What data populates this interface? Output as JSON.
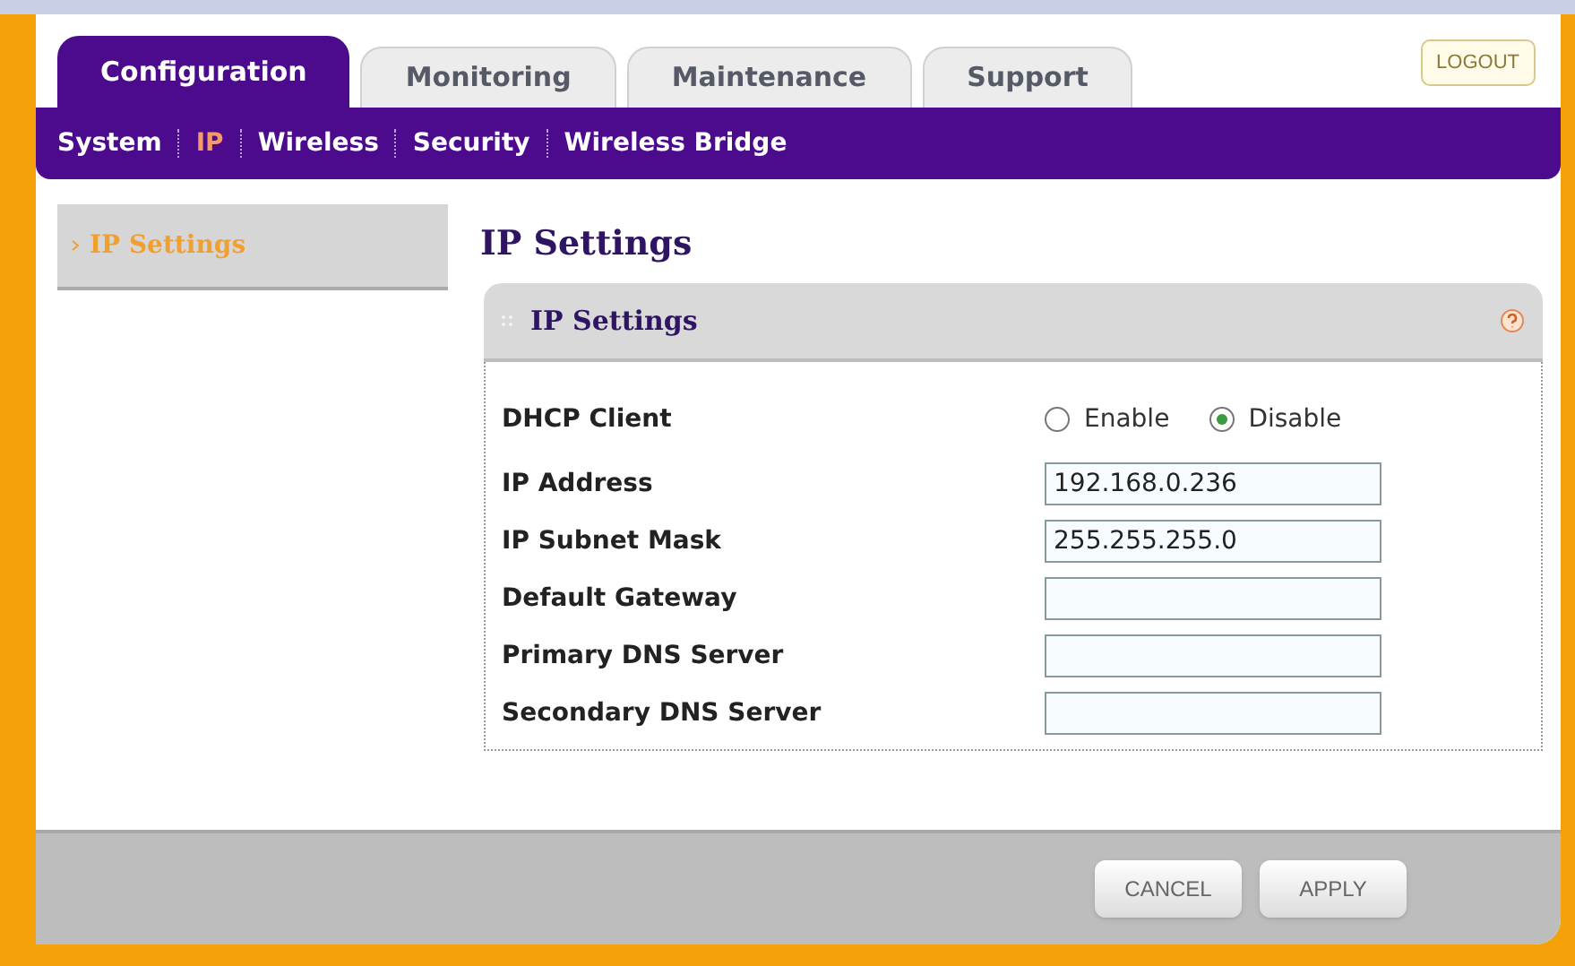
{
  "tabs": [
    {
      "label": "Configuration",
      "selected": true
    },
    {
      "label": "Monitoring",
      "selected": false
    },
    {
      "label": "Maintenance",
      "selected": false
    },
    {
      "label": "Support",
      "selected": false
    }
  ],
  "logout": "LOGOUT",
  "subnav": [
    {
      "label": "System",
      "selected": false
    },
    {
      "label": "IP",
      "selected": true
    },
    {
      "label": "Wireless",
      "selected": false
    },
    {
      "label": "Security",
      "selected": false
    },
    {
      "label": "Wireless Bridge",
      "selected": false
    }
  ],
  "sidebar": {
    "items": [
      {
        "label": "IP Settings",
        "selected": true
      }
    ]
  },
  "page_title": "IP Settings",
  "panel": {
    "title": "IP Settings",
    "rows": [
      {
        "kind": "radio",
        "label": "DHCP Client",
        "options": [
          {
            "label": "Enable",
            "selected": false
          },
          {
            "label": "Disable",
            "selected": true
          }
        ]
      },
      {
        "kind": "text",
        "label": "IP Address",
        "value": "192.168.0.236"
      },
      {
        "kind": "text",
        "label": "IP Subnet Mask",
        "value": "255.255.255.0"
      },
      {
        "kind": "text",
        "label": "Default Gateway",
        "value": ""
      },
      {
        "kind": "text",
        "label": "Primary DNS Server",
        "value": ""
      },
      {
        "kind": "text",
        "label": "Secondary DNS Server",
        "value": ""
      }
    ]
  },
  "buttons": [
    "CANCEL",
    "APPLY"
  ]
}
